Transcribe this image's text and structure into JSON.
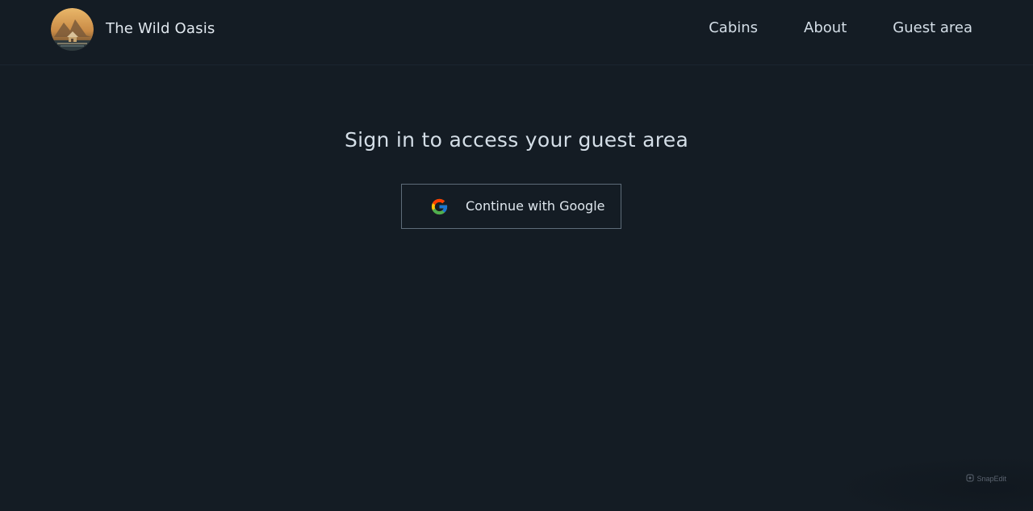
{
  "header": {
    "brand": "The Wild Oasis",
    "nav": [
      "Cabins",
      "About",
      "Guest area"
    ]
  },
  "main": {
    "title": "Sign in to access your guest area",
    "google_button_label": "Continue with Google"
  },
  "watermark": "SnapEdit",
  "colors": {
    "background": "#141c24",
    "text": "#d4dee7",
    "button_border": "#5e6c79"
  }
}
